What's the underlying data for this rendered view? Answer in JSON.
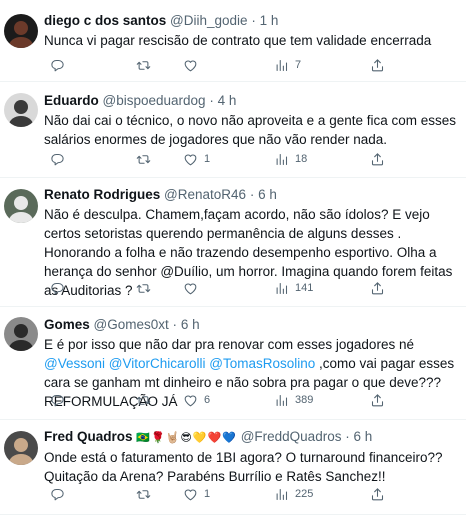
{
  "tweets": [
    {
      "name": "diego c dos santos",
      "handle": "@Diih_godie",
      "dot": "·",
      "time": "1 h",
      "emojis": "",
      "text_parts": [
        {
          "t": "Nunca vi pagar rescisão de contrato que tem validade encerrada",
          "m": false
        }
      ],
      "replies": "",
      "likes": "",
      "views": "7",
      "avatar_bg": "#1b1b1b",
      "avatar_fg": "#6b3a2a"
    },
    {
      "name": "Eduardo",
      "handle": "@bispoeduardog",
      "dot": "·",
      "time": "4 h",
      "emojis": "",
      "text_parts": [
        {
          "t": "Não dai cai o técnico, o novo não aproveita e a gente fica com esses salários enormes de jogadores que não vão render nada.",
          "m": false
        }
      ],
      "replies": "",
      "likes": "1",
      "views": "18",
      "avatar_bg": "#d9d9d9",
      "avatar_fg": "#3a3a3a"
    },
    {
      "name": "Renato Rodrigues",
      "handle": "@RenatoR46",
      "dot": "·",
      "time": "6 h",
      "emojis": "",
      "text_parts": [
        {
          "t": "Não é desculpa. Chamem,façam acordo, não são ídolos?  E vejo certos setoristas querendo permanência de alguns desses . Honorando a folha e não trazendo desempenho esportivo. Olha a herança do senhor @Duílio, um horror. Imagina quando forem feitas as Auditorias ?",
          "m": false
        }
      ],
      "replies": "",
      "likes": "",
      "views": "141",
      "avatar_bg": "#5a6a5a",
      "avatar_fg": "#e8e8e8"
    },
    {
      "name": "Gomes",
      "handle": "@Gomes0xt",
      "dot": "·",
      "time": "6 h",
      "emojis": "",
      "text_parts": [
        {
          "t": "E é por isso que não dar pra renovar com esses jogadores né ",
          "m": false
        },
        {
          "t": "@Vessoni",
          "m": true
        },
        {
          "t": " ",
          "m": false
        },
        {
          "t": "@VitorChicarolli",
          "m": true
        },
        {
          "t": " ",
          "m": false
        },
        {
          "t": "@TomasRosolino",
          "m": true
        },
        {
          "t": " ,como vai pagar esses cara se ganham mt dinheiro e não sobra pra pagar o que deve??? REFORMULAÇÃO JÁ",
          "m": false
        }
      ],
      "replies": "",
      "likes": "6",
      "views": "389",
      "avatar_bg": "#8a8a8a",
      "avatar_fg": "#2a2a2a"
    },
    {
      "name": "Fred Quadros",
      "handle": "@FreddQuadros",
      "dot": "·",
      "time": "6 h",
      "emojis": "🇧🇷🌹🤘🏼😎💛❤️💙",
      "text_parts": [
        {
          "t": "Onde está o faturamento de 1BI agora? O turnaround financeiro?? Quitação da Arena? Parabéns Burrílio e Ratês Sanchez!!",
          "m": false
        }
      ],
      "replies": "",
      "likes": "1",
      "views": "225",
      "avatar_bg": "#4a4a4a",
      "avatar_fg": "#c9a98a"
    }
  ]
}
